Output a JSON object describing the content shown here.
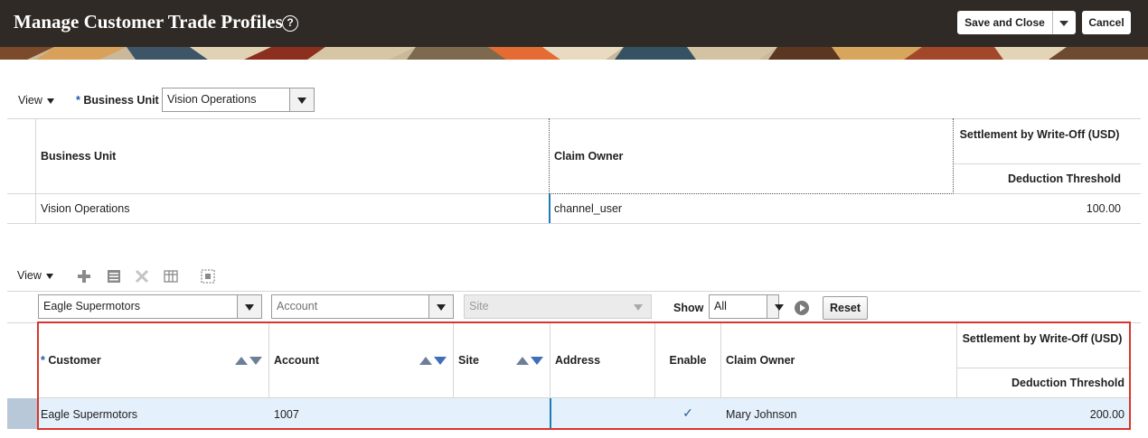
{
  "header": {
    "title": "Manage Customer Trade Profiles",
    "save_close_label": "Save and Close",
    "cancel_label": "Cancel"
  },
  "top_section": {
    "view_label": "View",
    "business_unit_label": "Business Unit",
    "business_unit_value": "Vision Operations",
    "columns": {
      "business_unit": "Business Unit",
      "claim_owner": "Claim Owner",
      "settlement_group": "Settlement by Write-Off (USD)",
      "deduction_threshold": "Deduction Threshold"
    },
    "row": {
      "business_unit": "Vision Operations",
      "claim_owner": "channel_user",
      "deduction_threshold": "100.00"
    }
  },
  "bottom_section": {
    "view_label": "View",
    "filters": {
      "customer_value": "Eagle Supermotors",
      "account_placeholder": "Account",
      "site_placeholder": "Site",
      "show_label": "Show",
      "show_value": "All",
      "reset_label": "Reset"
    },
    "columns": {
      "customer": "Customer",
      "account": "Account",
      "site": "Site",
      "address": "Address",
      "enable": "Enable",
      "claim_owner": "Claim Owner",
      "settlement_group": "Settlement by Write-Off (USD)",
      "deduction_threshold": "Deduction Threshold"
    },
    "row": {
      "customer": "Eagle Supermotors",
      "account": "1007",
      "site": "",
      "address": "",
      "enable_check": "✓",
      "claim_owner": "Mary Johnson",
      "deduction_threshold": "200.00"
    }
  },
  "colors": {
    "header_bg": "#2f2a26",
    "highlight_border": "#d9352b",
    "selected_row": "#e4f0fb",
    "required_marker": "#1a5aa6"
  }
}
